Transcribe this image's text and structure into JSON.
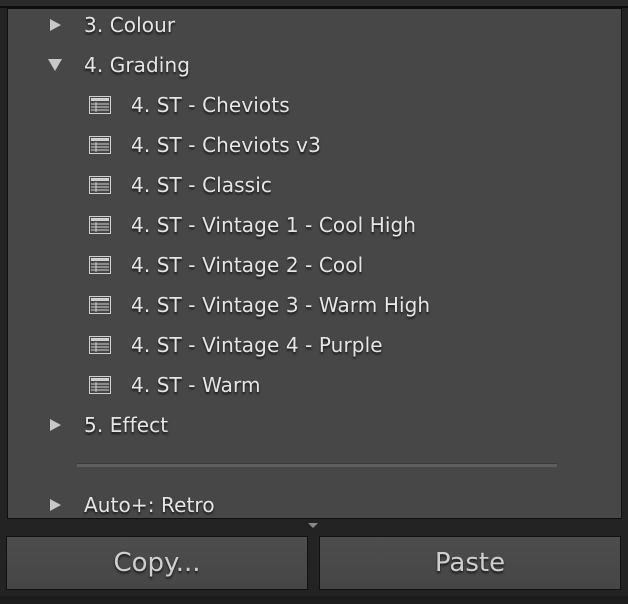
{
  "presets_panel": {
    "folders": [
      {
        "label": "3. Colour",
        "expanded": false
      },
      {
        "label": "4. Grading",
        "expanded": true
      },
      {
        "label": "5. Effect",
        "expanded": false
      },
      {
        "label": "Auto+: Retro",
        "expanded": false
      }
    ],
    "grading_presets": [
      "4. ST - Cheviots",
      "4. ST - Cheviots v3",
      "4. ST - Classic",
      "4. ST - Vintage 1 - Cool High",
      "4. ST - Vintage 2 - Cool",
      "4. ST - Vintage 3 - Warm High",
      "4. ST - Vintage 4 - Purple",
      "4. ST - Warm"
    ]
  },
  "footer": {
    "copy_label": "Copy...",
    "paste_label": "Paste"
  },
  "colors": {
    "panel_bg": "#474747",
    "text": "#e6e6e6",
    "button_text": "#cfcfcf"
  },
  "icons": {
    "collapsed": "triangle-right-icon",
    "expanded": "triangle-down-icon",
    "preset": "preset-list-icon"
  }
}
